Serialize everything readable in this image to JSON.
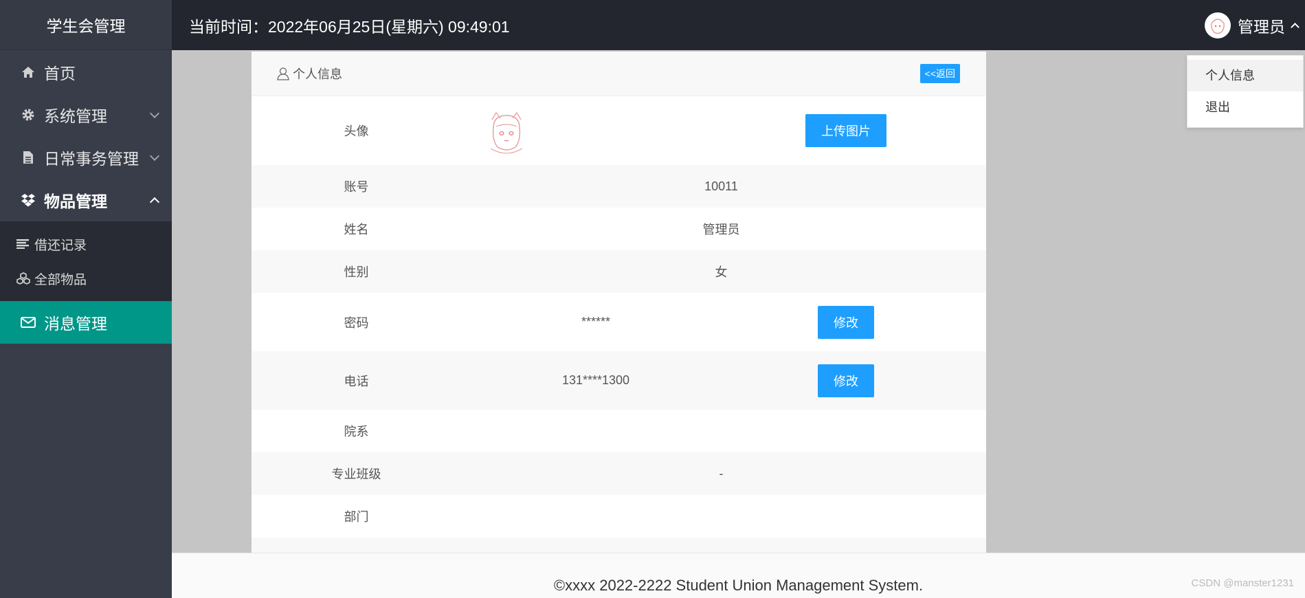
{
  "sidebar": {
    "brand": "学生会管理",
    "items": [
      {
        "label": "首页",
        "icon": "home-icon"
      },
      {
        "label": "系统管理",
        "icon": "gear-icon"
      },
      {
        "label": "日常事务管理",
        "icon": "document-icon"
      },
      {
        "label": "物品管理",
        "icon": "dropbox-icon"
      }
    ],
    "sub_items": [
      {
        "label": "借还记录",
        "icon": "list-icon"
      },
      {
        "label": "全部物品",
        "icon": "cubes-icon"
      }
    ],
    "active_item": {
      "label": "消息管理",
      "icon": "envelope-icon"
    },
    "active_color": "#009688"
  },
  "header": {
    "clock": "当前时间：2022年06月25日(星期六) 09:49:01",
    "user_name": "管理员"
  },
  "user_menu": {
    "items": [
      "个人信息",
      "退出"
    ]
  },
  "profile": {
    "title": "个人信息",
    "back_label": "<<返回",
    "avatar_label": "头像",
    "upload_label": "上传图片",
    "rows": {
      "account": {
        "label": "账号",
        "value": "10011"
      },
      "name": {
        "label": "姓名",
        "value": "管理员"
      },
      "gender": {
        "label": "性别",
        "value": "女"
      },
      "password": {
        "label": "密码",
        "value": "******",
        "button": "修改"
      },
      "phone": {
        "label": "电话",
        "value": "131****1300",
        "button": "修改"
      },
      "college": {
        "label": "院系",
        "value": ""
      },
      "major_class": {
        "label": "专业班级",
        "value": "-"
      },
      "department": {
        "label": "部门",
        "value": ""
      }
    },
    "accent_color": "#1e9fff"
  },
  "footer": {
    "copyright": "©xxxx 2022-2222 Student Union Management System."
  },
  "watermark": "CSDN @manster1231"
}
